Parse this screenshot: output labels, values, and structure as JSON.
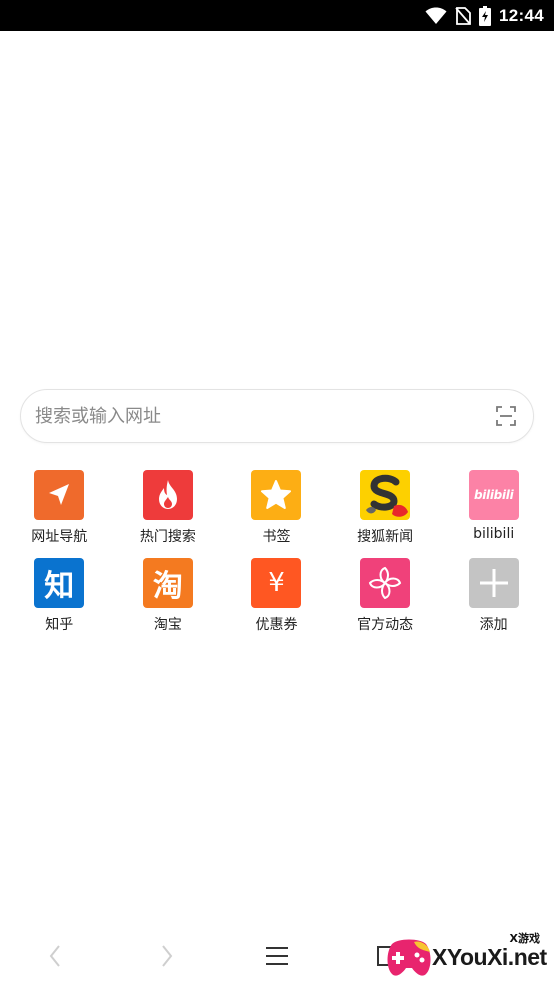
{
  "status_bar": {
    "time": "12:44",
    "icons": [
      "wifi-icon",
      "no-sim-icon",
      "battery-charging-icon"
    ]
  },
  "search": {
    "placeholder": "搜索或输入网址",
    "scan_icon": "scan-icon"
  },
  "shortcuts": [
    {
      "label": "网址导航",
      "icon": "navigation-arrow-icon",
      "color": "#EF6A2C"
    },
    {
      "label": "热门搜索",
      "icon": "flame-icon",
      "color": "#EE3B3B"
    },
    {
      "label": "书签",
      "icon": "star-icon",
      "color": "#FDAE14"
    },
    {
      "label": "搜狐新闻",
      "icon": "sohu-logo-icon",
      "color": "#FDD000"
    },
    {
      "label": "bilibili",
      "icon": "bilibili-logo-icon",
      "color": "#FC82A6",
      "logo_text": "bilibili"
    },
    {
      "label": "知乎",
      "icon": "zhihu-logo-icon",
      "color": "#0A73CF",
      "logo_text": "知"
    },
    {
      "label": "淘宝",
      "icon": "taobao-logo-icon",
      "color": "#F47A20",
      "logo_text": "淘"
    },
    {
      "label": "优惠券",
      "icon": "yen-icon",
      "color": "#FF5722",
      "logo_text": "¥"
    },
    {
      "label": "官方动态",
      "icon": "pinwheel-icon",
      "color": "#F0417A"
    },
    {
      "label": "添加",
      "icon": "plus-icon",
      "color": "#C4C4C4"
    }
  ],
  "bottom_nav": {
    "items": [
      "back-icon",
      "forward-icon",
      "menu-icon",
      "tabs-icon"
    ],
    "disabled_color": "#CFCFCF",
    "active_color": "#333333"
  },
  "watermark": {
    "badge": "X游戏",
    "site": "XYouXi.net"
  }
}
